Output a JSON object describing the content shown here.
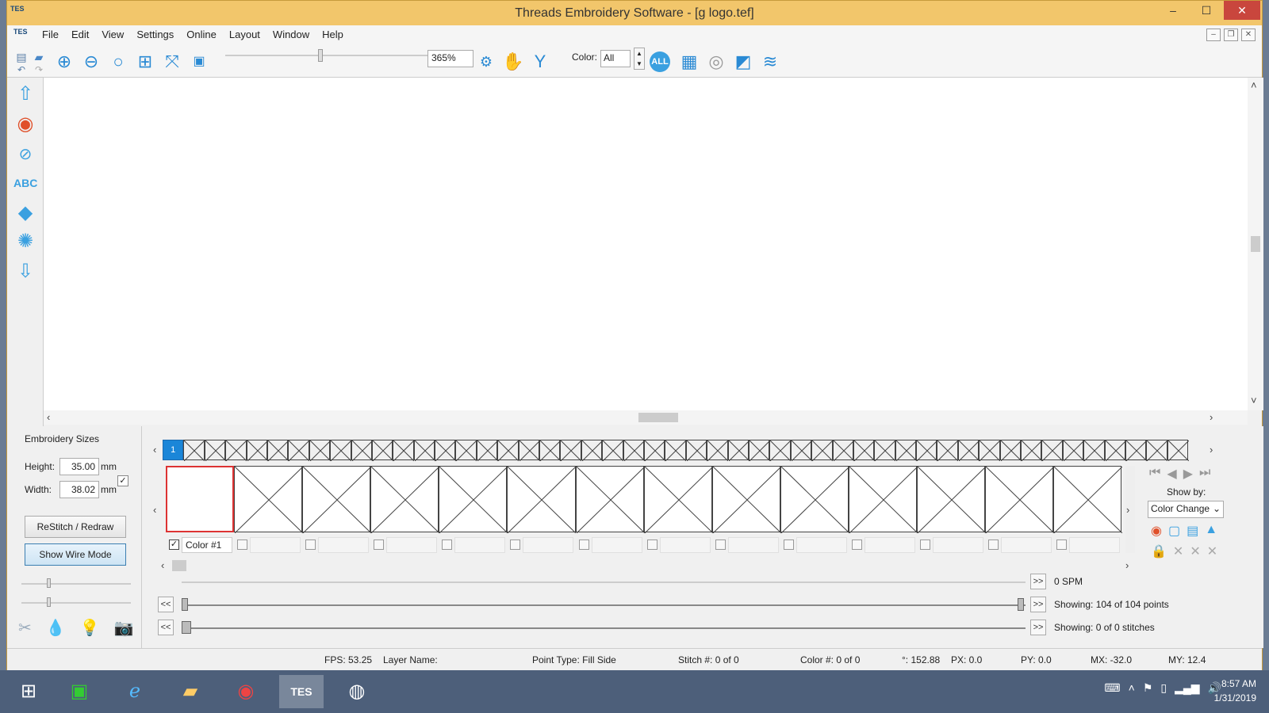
{
  "window": {
    "title": "Threads Embroidery Software - [g logo.tef]",
    "logo_text": "TES",
    "minimize": "–",
    "maximize": "☐",
    "close": "✕"
  },
  "menu": {
    "items": [
      "File",
      "Edit",
      "View",
      "Settings",
      "Online",
      "Layout",
      "Window",
      "Help"
    ],
    "mdi_buttons": [
      "–",
      "❐",
      "✕"
    ]
  },
  "toolbar": {
    "zoom_value": "365%",
    "zoom_level_fraction": 0.47,
    "color_label": "Color:",
    "color_value": "All",
    "all_button": "ALL",
    "icons": [
      "zoom-in-icon",
      "zoom-out-icon",
      "zoom-icon",
      "zoom-fit-icon",
      "zoom-extents-icon",
      "zoom-100-icon",
      "stitch-icon",
      "hand-icon",
      "v-icon",
      "all-colors-icon",
      "grid-icon",
      "hoop-icon",
      "page-icon",
      "wifi-icon"
    ]
  },
  "left_tools": [
    "arrow-up-icon",
    "circle-target-icon",
    "paperclip-icon",
    "abc-text-icon",
    "cube-icon",
    "gear-star-icon",
    "arrow-down-icon"
  ],
  "sizes": {
    "title": "Embroidery Sizes",
    "height_label": "Height:",
    "height_value": "35.00",
    "width_label": "Width:",
    "width_value": "38.02",
    "unit": "mm",
    "restitch_button": "ReStitch / Redraw",
    "wire_button": "Show Wire Mode"
  },
  "color_strip": {
    "first_label": "1",
    "cell_count": 49
  },
  "colors": {
    "items": [
      {
        "label": "Color #1",
        "checked": true
      },
      {
        "label": "",
        "checked": false
      },
      {
        "label": "",
        "checked": false
      },
      {
        "label": "",
        "checked": false
      },
      {
        "label": "",
        "checked": false
      },
      {
        "label": "",
        "checked": false
      },
      {
        "label": "",
        "checked": false
      },
      {
        "label": "",
        "checked": false
      },
      {
        "label": "",
        "checked": false
      },
      {
        "label": "",
        "checked": false
      },
      {
        "label": "",
        "checked": false
      },
      {
        "label": "",
        "checked": false
      },
      {
        "label": "",
        "checked": false
      },
      {
        "label": "",
        "checked": false
      }
    ]
  },
  "nav": {
    "show_by_label": "Show by:",
    "show_by_value": "Color Change"
  },
  "playback": {
    "spm": "0 SPM",
    "points": "Showing: 104 of 104 points",
    "stitches": "Showing: 0 of 0 stitches",
    "prev": "<<",
    "next": ">>"
  },
  "status": {
    "fps": "FPS: 53.25",
    "layer": "Layer Name:",
    "point_type": "Point Type: Fill Side",
    "stitch": "Stitch #: 0 of 0",
    "color": "Color #: 0 of 0",
    "angle": "°: 152.88",
    "px": "PX: 0.0",
    "py": "PY: 0.0",
    "mx": "MX: -32.0",
    "my": "MY: 12.4"
  },
  "taskbar": {
    "time": "8:57 AM",
    "date": "1/31/2019",
    "apps": [
      "windows-start-icon",
      "store-icon",
      "ie-icon",
      "file-explorer-icon",
      "chrome-icon",
      "tes-app-icon",
      "obs-icon"
    ]
  }
}
